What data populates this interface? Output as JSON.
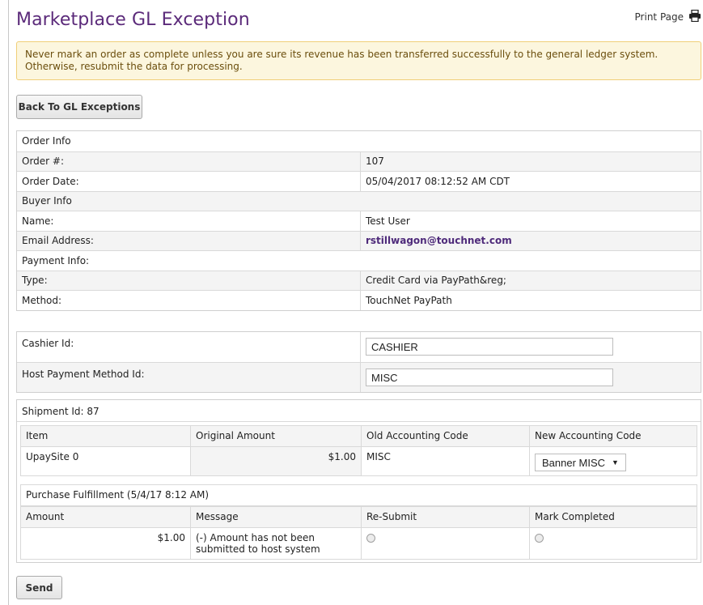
{
  "header": {
    "title": "Marketplace GL Exception",
    "print_label": "Print Page"
  },
  "alert": {
    "text": "Never mark an order as complete unless you are sure its revenue has been transferred successfully to the general ledger system. Otherwise, resubmit the data for processing."
  },
  "back_button": "Back To GL Exceptions",
  "order": {
    "section": "Order Info",
    "number_label": "Order #:",
    "number": "107",
    "date_label": "Order Date:",
    "date": "05/04/2017 08:12:52 AM CDT"
  },
  "buyer": {
    "section": "Buyer Info",
    "name_label": "Name:",
    "name": "Test User",
    "email_label": "Email Address:",
    "email": "rstillwagon@touchnet.com"
  },
  "payment": {
    "section": "Payment Info:",
    "type_label": "Type:",
    "type": "Credit Card via PayPath&reg;",
    "method_label": "Method:",
    "method": "TouchNet PayPath"
  },
  "fields": {
    "cashier_label": "Cashier Id:",
    "cashier_value": "CASHIER",
    "host_label": "Host Payment Method Id:",
    "host_value": "MISC"
  },
  "shipment": {
    "title": "Shipment Id: 87",
    "headers": [
      "Item",
      "Original Amount",
      "Old Accounting Code",
      "New Accounting Code"
    ],
    "row": {
      "item": "UpaySite 0",
      "amount": "$1.00",
      "old_code": "MISC",
      "new_code": "Banner MISC"
    }
  },
  "fulfillment": {
    "title": "Purchase Fulfillment (5/4/17 8:12 AM)",
    "headers": [
      "Amount",
      "Message",
      "Re-Submit",
      "Mark Completed"
    ],
    "row": {
      "amount": "$1.00",
      "message": "(-) Amount has not been submitted to host system"
    }
  },
  "send_button": "Send"
}
